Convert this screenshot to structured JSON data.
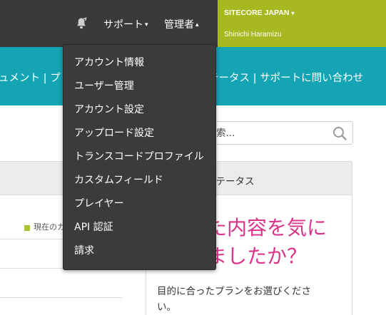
{
  "header": {
    "bell_icon": "bell-icon",
    "support_label": "サポート",
    "support_caret": "▾",
    "admin_label": "管理者",
    "admin_caret": "▴",
    "account": {
      "org": "SITECORE JAPAN",
      "org_caret": "▾",
      "user": "Shinichi Haramizu"
    },
    "colors": {
      "topbar": "#3a3a3a",
      "account_box": "#a7b820",
      "teal": "#14a4b4"
    }
  },
  "subnav": {
    "left_partial": "ュメント | プ",
    "right_items": [
      "テータス",
      "サポートに問い合わせ"
    ],
    "separator": " | "
  },
  "search": {
    "placeholder": "索...",
    "icon": "search-icon"
  },
  "status_panel": {
    "header": "ステータス",
    "promo_title": "た内容を気に\nしましたか？",
    "promo_title_line1": "た内容を気に",
    "promo_title_line2": "ましたか？",
    "promo_body_line1": "目的に合ったプランをお選びくださ",
    "promo_body_line2": "い。",
    "accent_color": "#d9348a"
  },
  "left_panel": {
    "legend_text": "現在のカ",
    "legend_color": "#a7c52e"
  },
  "admin_menu": {
    "items": [
      "アカウント情報",
      "ユーザー管理",
      "アカウント設定",
      "アップロード設定",
      "トランスコードプロファイル",
      "カスタムフィールド",
      "プレイヤー",
      "API 認証",
      "請求"
    ]
  }
}
